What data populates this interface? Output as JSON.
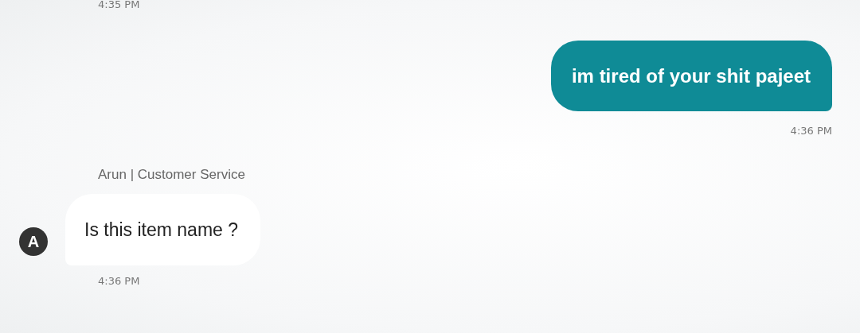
{
  "previous_time": "4:35 PM",
  "messages": [
    {
      "kind": "outgoing",
      "text": "im tired of your shit pajeet",
      "time": "4:36 PM"
    },
    {
      "kind": "incoming",
      "sender": "Arun | Customer Service",
      "avatar": "A",
      "text": "Is this item name ?",
      "time": "4:36 PM"
    }
  ]
}
